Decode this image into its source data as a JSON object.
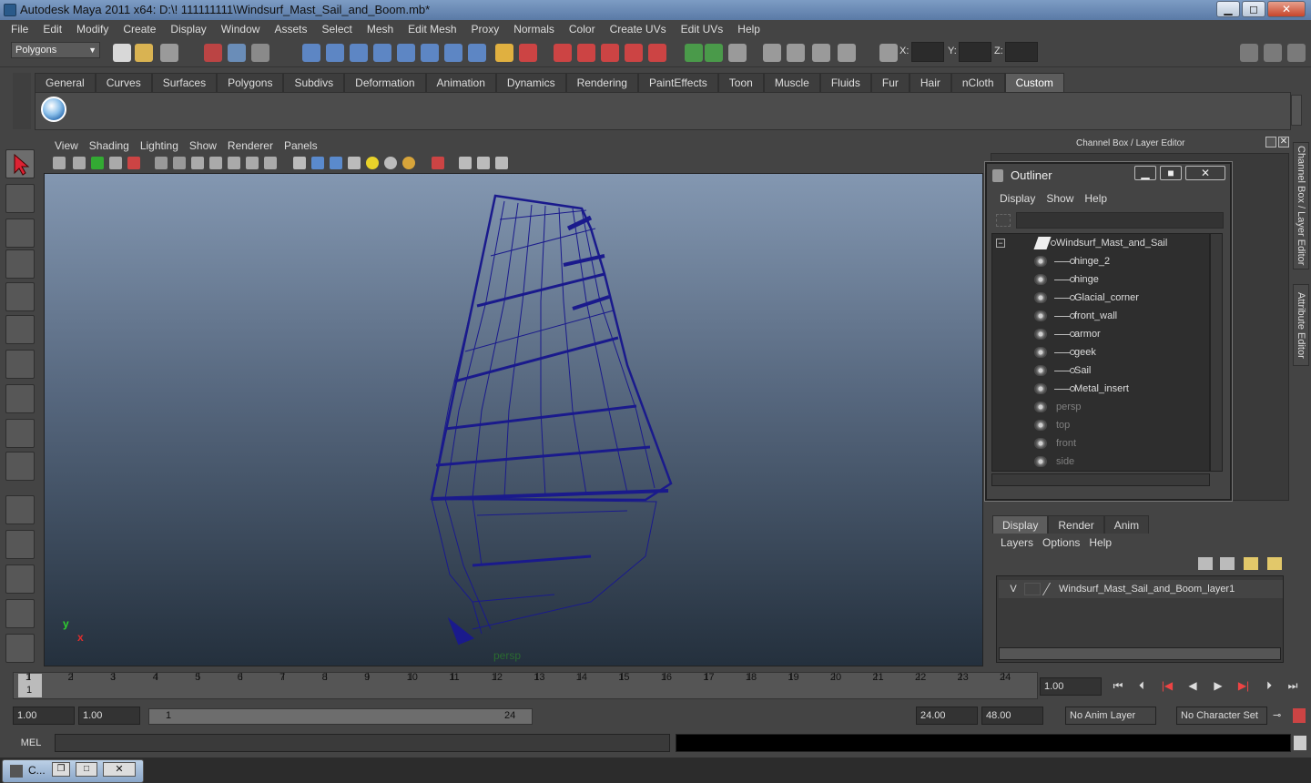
{
  "window": {
    "title": "Autodesk Maya 2011 x64: D:\\! 111111111\\Windsurf_Mast_Sail_and_Boom.mb*",
    "min": "▁",
    "max": "◻",
    "close": "✕"
  },
  "menubar": [
    "File",
    "Edit",
    "Modify",
    "Create",
    "Display",
    "Window",
    "Assets",
    "Select",
    "Mesh",
    "Edit Mesh",
    "Proxy",
    "Normals",
    "Color",
    "Create UVs",
    "Edit UVs",
    "Help"
  ],
  "statusline": {
    "mode": "Polygons",
    "x_label": "X:",
    "y_label": "Y:",
    "z_label": "Z:"
  },
  "shelf": {
    "tabs": [
      "General",
      "Curves",
      "Surfaces",
      "Polygons",
      "Subdivs",
      "Deformation",
      "Animation",
      "Dynamics",
      "Rendering",
      "PaintEffects",
      "Toon",
      "Muscle",
      "Fluids",
      "Fur",
      "Hair",
      "nCloth",
      "Custom"
    ],
    "active_tab": "Custom"
  },
  "panel": {
    "menus": [
      "View",
      "Shading",
      "Lighting",
      "Show",
      "Renderer",
      "Panels"
    ],
    "camera": "persp",
    "axis_y": "y",
    "axis_x": "x"
  },
  "channel_box": {
    "title": "Channel Box / Layer Editor"
  },
  "side_tabs": [
    "Channel Box / Layer Editor",
    "Attribute Editor"
  ],
  "outliner": {
    "title": "Outliner",
    "menus": [
      "Display",
      "Show",
      "Help"
    ],
    "root": "Windsurf_Mast_and_Sail",
    "children": [
      "hinge_2",
      "hinge",
      "Glacial_corner",
      "front_wall",
      "armor",
      "geek",
      "Sail",
      "Metal_insert"
    ],
    "cameras": [
      "persp",
      "top",
      "front",
      "side"
    ],
    "buttons": {
      "min": "▁",
      "max": "■",
      "close": "✕"
    }
  },
  "layer_editor": {
    "tabs": [
      "Display",
      "Render",
      "Anim"
    ],
    "active_tab": "Display",
    "menus": [
      "Layers",
      "Options",
      "Help"
    ],
    "layer": {
      "visibility": "V",
      "name": "Windsurf_Mast_Sail_and_Boom_layer1"
    }
  },
  "time_slider": {
    "ticks": [
      1,
      2,
      3,
      4,
      5,
      6,
      7,
      8,
      9,
      10,
      11,
      12,
      13,
      14,
      15,
      16,
      17,
      18,
      19,
      20,
      21,
      22,
      23,
      24
    ],
    "current_frame_marker": "1",
    "current_time": "1.00"
  },
  "range_slider": {
    "start": "1.00",
    "playback_start": "1.00",
    "range_start": "1",
    "range_end": "24",
    "playback_end": "24.00",
    "end": "48.00",
    "anim_layer": "No Anim Layer",
    "character_set": "No Character Set"
  },
  "command_line": {
    "label": "MEL"
  },
  "taskbar": {
    "item": "C..."
  },
  "colors": {
    "wireframe": "#1a1a8c",
    "accent": "#5d5d5d"
  }
}
